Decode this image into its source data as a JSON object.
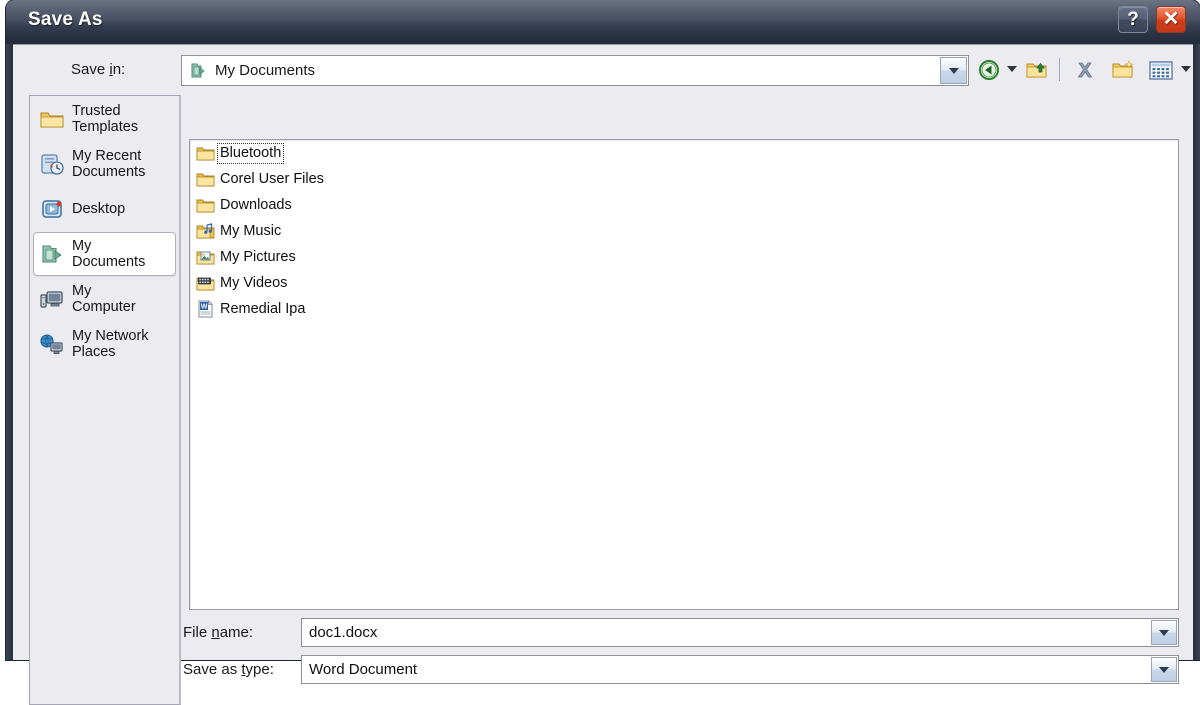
{
  "window": {
    "title": "Save As",
    "help_button": "?",
    "close_button": "✕"
  },
  "toolbar_top": {
    "savein_label": "Save in:",
    "savein_label_pre": "Save ",
    "savein_label_accel": "i",
    "savein_label_post": "n:",
    "savein_value": "My Documents",
    "savein_icon": "my-documents-icon",
    "savein_dropdown_icon": "chevron-down-icon",
    "buttons": [
      {
        "name": "back-button",
        "icon": "back-arrow-icon"
      },
      {
        "name": "back-dropdown",
        "icon": "chevron-down-icon"
      },
      {
        "name": "up-one-level-button",
        "icon": "up-folder-icon"
      },
      {
        "name": "delete-button",
        "icon": "delete-x-icon"
      },
      {
        "name": "new-folder-button",
        "icon": "new-folder-icon"
      },
      {
        "name": "views-button",
        "icon": "views-grid-icon"
      },
      {
        "name": "views-dropdown",
        "icon": "chevron-down-icon"
      }
    ]
  },
  "places": {
    "items": [
      {
        "label": "Trusted\nTemplates",
        "icon": "folder-icon",
        "selected": false
      },
      {
        "label": "My Recent\nDocuments",
        "icon": "recent-documents-icon",
        "selected": false
      },
      {
        "label": "Desktop",
        "icon": "desktop-icon",
        "selected": false
      },
      {
        "label": "My\nDocuments",
        "icon": "my-documents-icon",
        "selected": true
      },
      {
        "label": "My\nComputer",
        "icon": "my-computer-icon",
        "selected": false
      },
      {
        "label": "My Network\nPlaces",
        "icon": "network-places-icon",
        "selected": false
      }
    ]
  },
  "file_list": {
    "items": [
      {
        "name": "Bluetooth",
        "icon": "folder-icon",
        "focused": true
      },
      {
        "name": "Corel User Files",
        "icon": "folder-icon",
        "focused": false
      },
      {
        "name": "Downloads",
        "icon": "folder-icon",
        "focused": false
      },
      {
        "name": "My Music",
        "icon": "music-folder-icon",
        "focused": false
      },
      {
        "name": "My Pictures",
        "icon": "pictures-folder-icon",
        "focused": false
      },
      {
        "name": "My Videos",
        "icon": "videos-folder-icon",
        "focused": false
      },
      {
        "name": "Remedial Ipa",
        "icon": "word-document-icon",
        "focused": false
      }
    ]
  },
  "fields": {
    "filename_label": "File name:",
    "filename_label_pre": "File ",
    "filename_label_accel": "n",
    "filename_label_post": "ame:",
    "filename_value": "doc1.docx",
    "filetype_label": "Save as type:",
    "filetype_label_pre": "Save as ",
    "filetype_label_accel": "t",
    "filetype_label_post": "ype:",
    "filetype_value": "Word Document",
    "dropdown_icon": "chevron-down-icon"
  },
  "colors": {
    "titlebar_top": "#6b7384",
    "titlebar_bottom": "#242b3a",
    "dialog_body": "#ebebf0",
    "close_button": "#cf3d1b",
    "folder_gold": "#f3c44a",
    "selection_white": "#ffffff"
  }
}
